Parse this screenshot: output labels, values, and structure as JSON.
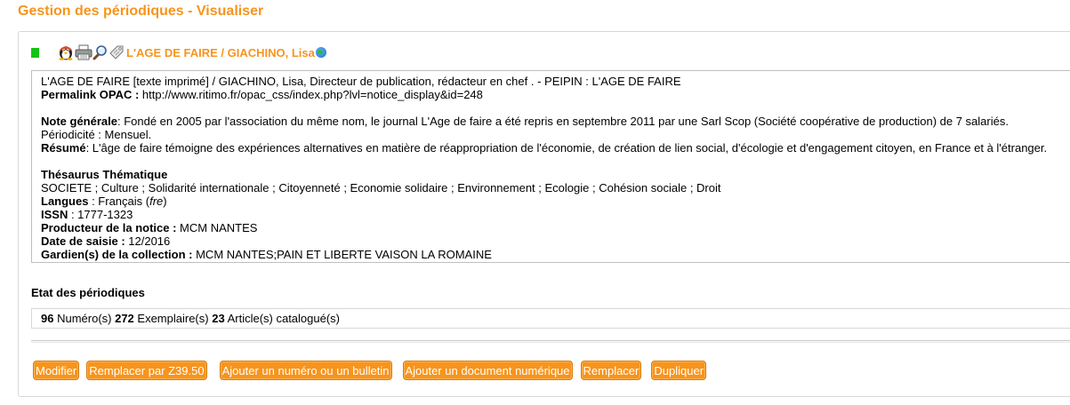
{
  "page": {
    "title": "Gestion des périodiques - Visualiser"
  },
  "notice": {
    "title": "L'AGE DE FAIRE / GIACHINO, Lisa",
    "header_icons": [
      "tux-icon",
      "print-icon",
      "magnifier-icon",
      "tag-icon",
      "globe-icon"
    ],
    "status_color": "#13c313",
    "line1": "L'AGE DE FAIRE [texte imprimé] / GIACHINO, Lisa, Directeur de publication, rédacteur en chef . - PEIPIN : L'AGE DE FAIRE",
    "permalink": {
      "label": "Permalink OPAC :",
      "value": " http://www.ritimo.fr/opac_css/index.php?lvl=notice_display&id=248"
    },
    "note_generale": {
      "label": "Note générale",
      "value": ": Fondé en 2005 par l'association du même nom, le journal L'Age de faire a été repris en septembre 2011 par une Sarl Scop (Société coopérative de production) de 7 salariés."
    },
    "periodicite": "Périodicité : Mensuel.",
    "resume": {
      "label": "Résumé",
      "value": ": L'âge de faire témoigne des expériences alternatives en matière de réappropriation de l'économie, de création de lien social, d'écologie et d'engagement citoyen, en France et à l'étranger."
    },
    "thesaurus": {
      "label": "Thésaurus Thématique",
      "value": "SOCIETE ; Culture ; Solidarité internationale ; Citoyenneté ; Economie solidaire ; Environnement ; Ecologie ; Cohésion sociale ; Droit"
    },
    "langues": {
      "label": "Langues",
      "value_pre": " : Français (",
      "code": "fre",
      "value_post": ")"
    },
    "issn": {
      "label": "ISSN",
      "value": " : 1777-1323"
    },
    "producteur": {
      "label": "Producteur de la notice :",
      "value": " MCM NANTES"
    },
    "date_saisie": {
      "label": "Date de saisie :",
      "value": " 12/2016"
    },
    "gardiens": {
      "label": "Gardien(s) de la collection :",
      "value": " MCM NANTES;PAIN ET LIBERTE VAISON LA ROMAINE"
    }
  },
  "etat": {
    "title": "Etat des périodiques",
    "numeros_count": "96",
    "numeros_label": " Numéro(s) ",
    "exemplaires_count": "272",
    "exemplaires_label": " Exemplaire(s) ",
    "articles_count": "23",
    "articles_label": " Article(s) catalogué(s)"
  },
  "buttons": {
    "modifier": "Modifier",
    "remplacer_z3950": "Remplacer par Z39.50",
    "ajouter_numero": "Ajouter un numéro ou un bulletin",
    "ajouter_document": "Ajouter un document numérique",
    "remplacer": "Remplacer",
    "dupliquer": "Dupliquer"
  },
  "colors": {
    "accent": "#f7941d",
    "status": "#13c313"
  }
}
